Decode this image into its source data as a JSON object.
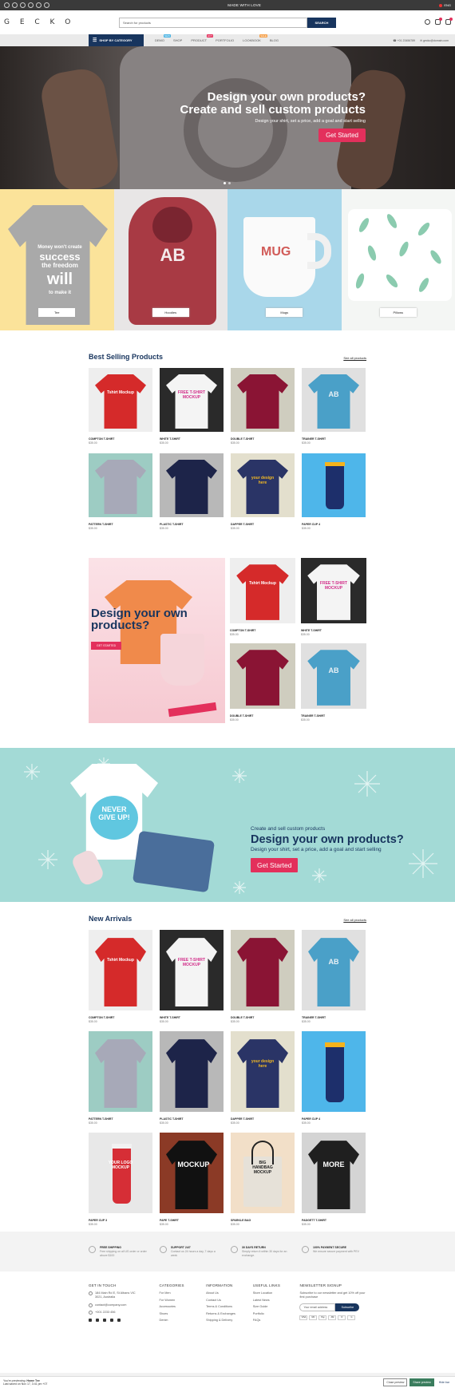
{
  "topbar": {
    "message": "MADE WITH LOVE",
    "lang": "ENG"
  },
  "header": {
    "logo": "G E C K O",
    "search_placeholder": "Search for products",
    "search_button": "SEARCH"
  },
  "nav": {
    "category_button": "SHOP BY CATEGORY",
    "items": [
      {
        "label": "DEMO",
        "tag": "NEW",
        "tag_color": "#4ab3e3"
      },
      {
        "label": "SHOP",
        "tag": "",
        "tag_color": ""
      },
      {
        "label": "PRODUCT",
        "tag": "HOT",
        "tag_color": "#e3305c"
      },
      {
        "label": "PORTFOLIO",
        "tag": "",
        "tag_color": ""
      },
      {
        "label": "LOOKBOOK",
        "tag": "SALE",
        "tag_color": "#f5a04a"
      },
      {
        "label": "BLOG",
        "tag": "",
        "tag_color": ""
      }
    ],
    "phone": "+01 23456789",
    "email": "gecko@domain.com"
  },
  "hero": {
    "title1": "Design your own products?",
    "title2": "Create and sell custom products",
    "subtitle": "Design your shirt, set a price, add a goal and start selling",
    "button": "Get Started"
  },
  "categories": [
    {
      "label": "Tee",
      "bg": "#fbe39a",
      "shirt_text": [
        "Money won't create",
        "success",
        "the freedom",
        "will",
        "to make it"
      ]
    },
    {
      "label": "Hoodies",
      "bg": "#e8e6e6"
    },
    {
      "label": "Mugs",
      "bg": "#a9d7ea",
      "mug_text": "MUG"
    },
    {
      "label": "Pillows",
      "bg": "#f4f6f4"
    }
  ],
  "best_selling": {
    "title": "Best Selling Products",
    "see_all": "See all products",
    "products": [
      {
        "name": "COMPTON T-SHIRT",
        "price": "$35.00",
        "bg": "#eeeeee",
        "shirt": "#d52a2a",
        "text": "Tshirt Mockup"
      },
      {
        "name": "WHITE T-SHIRT",
        "price": "$35.00",
        "bg": "#2a2a2a",
        "shirt": "#f4f4f4",
        "text": "FREE T-SHIRT MOCKUP"
      },
      {
        "name": "DOUBLE T-SHIRT",
        "price": "$35.00",
        "bg": "#cfcdbf",
        "shirt": "#8a1434",
        "text": ""
      },
      {
        "name": "TRAINER T-SHIRT",
        "price": "$35.00",
        "bg": "#e0e0e0",
        "shirt": "#4aa0c8",
        "text": "AB"
      },
      {
        "name": "PATTERN T-SHIRT",
        "price": "$35.00",
        "bg": "#9dccc3",
        "shirt": "#a7a9b8",
        "text": ""
      },
      {
        "name": "PLASTIC T-SHIRT",
        "price": "$35.00",
        "bg": "#b8b8b8",
        "shirt": "#1d2449",
        "text": ""
      },
      {
        "name": "DAPPER T-SHIRT",
        "price": "$35.00",
        "bg": "#e3dfcd",
        "shirt": "#2a3466",
        "text": "your design here"
      },
      {
        "name": "PAPER CUP 4",
        "price": "$35.00",
        "bg": "#4eb6ea",
        "shirt": "",
        "text": ""
      }
    ]
  },
  "promo": {
    "title": "Design your own products?",
    "button": "GET STARTED",
    "products": [
      {
        "name": "COMPTON T-SHIRT",
        "price": "$35.00",
        "bg": "#eeeeee",
        "shirt": "#d52a2a",
        "text": "Tshirt Mockup"
      },
      {
        "name": "WHITE T-SHIRT",
        "price": "$35.00",
        "bg": "#2a2a2a",
        "shirt": "#f4f4f4",
        "text": "FREE T-SHIRT MOCKUP"
      },
      {
        "name": "DOUBLE T-SHIRT",
        "price": "$35.00",
        "bg": "#cfcdbf",
        "shirt": "#8a1434",
        "text": ""
      },
      {
        "name": "TRAINER T-SHIRT",
        "price": "$35.00",
        "bg": "#e0e0e0",
        "shirt": "#4aa0c8",
        "text": "AB"
      }
    ]
  },
  "banner": {
    "subtitle": "Create and sell custom products",
    "title": "Design your own products?",
    "desc": "Design your shirt, set a price, add a goal and start selling",
    "button": "Get Started",
    "shirt_text": "NEVER GIVE UP!"
  },
  "new_arrivals": {
    "title": "New Arrivals",
    "see_all": "See all products",
    "products": [
      {
        "name": "COMPTON T-SHIRT",
        "price": "$35.00",
        "bg": "#eeeeee",
        "shirt": "#d52a2a",
        "text": "Tshirt Mockup"
      },
      {
        "name": "WHITE T-SHIRT",
        "price": "$35.00",
        "bg": "#2a2a2a",
        "shirt": "#f4f4f4",
        "text": "FREE T-SHIRT MOCKUP"
      },
      {
        "name": "DOUBLE T-SHIRT",
        "price": "$35.00",
        "bg": "#cfcdbf",
        "shirt": "#8a1434",
        "text": ""
      },
      {
        "name": "TRAINER T-SHIRT",
        "price": "$35.00",
        "bg": "#e0e0e0",
        "shirt": "#4aa0c8",
        "text": "AB"
      },
      {
        "name": "PATTERN T-SHIRT",
        "price": "$35.00",
        "bg": "#9dccc3",
        "shirt": "#a7a9b8",
        "text": ""
      },
      {
        "name": "PLASTIC T-SHIRT",
        "price": "$35.00",
        "bg": "#b8b8b8",
        "shirt": "#1d2449",
        "text": ""
      },
      {
        "name": "DAPPER T-SHIRT",
        "price": "$35.00",
        "bg": "#e3dfcd",
        "shirt": "#2a3466",
        "text": "your design here"
      },
      {
        "name": "PAPER CUP 4",
        "price": "$35.00",
        "bg": "#4eb6ea",
        "shirt": "",
        "text": ""
      },
      {
        "name": "PAPER CUP 3",
        "price": "$35.00",
        "bg": "#e8e8e8",
        "shirt": "",
        "text": "YOUR LOGO MOCKUP"
      },
      {
        "name": "PAPE T-SHIRT",
        "price": "$35.00",
        "bg": "#8b3a26",
        "shirt": "#111111",
        "text": "MOCKUP"
      },
      {
        "name": "SPARKLE BAG",
        "price": "$35.00",
        "bg": "#f2dfc8",
        "shirt": "",
        "text": "BIG HANDBAG MOCKUP"
      },
      {
        "name": "PADGETT T-SHIRT",
        "price": "$35.00",
        "bg": "#d4d4d4",
        "shirt": "#1f1f1f",
        "text": "MORE"
      }
    ]
  },
  "features": [
    {
      "title": "FREE SHIPPING",
      "desc": "Free shipping on all US order or order above $100"
    },
    {
      "title": "SUPPORT 24/7",
      "desc": "Contact us 24 hours a day, 7 days a week"
    },
    {
      "title": "30 DAYS RETURN",
      "desc": "Simply return it within 30 days for an exchange."
    },
    {
      "title": "100% PAYMENT SECURE",
      "desc": "We ensure secure payment with PEV"
    }
  ],
  "footer": {
    "get_in_touch": {
      "title": "GET IN TOUCH",
      "address": "184 Main Rd E, St Albans VIC 3021, Australia",
      "email": "contact@company.com",
      "phone": "+001 2233 456"
    },
    "categories": {
      "title": "CATEGORIES",
      "links": [
        "For Men",
        "For Women",
        "Accessories",
        "Shoes",
        "Denim"
      ]
    },
    "information": {
      "title": "INFORMATION",
      "links": [
        "About Us",
        "Contact Us",
        "Terms & Conditions",
        "Returns & Exchanges",
        "Shipping & Delivery"
      ]
    },
    "useful_links": {
      "title": "USEFUL LINKS",
      "links": [
        "Store Location",
        "Latest News",
        "Size Guide",
        "Portfolio",
        "FAQs"
      ]
    },
    "newsletter": {
      "title": "NEWSLETTER SIGNUP",
      "desc": "Subscribe to our newsletter and get 10% off your first purchase",
      "placeholder": "Your email address",
      "button": "Subscribe",
      "payments": [
        "VISA",
        "MC",
        "Pay",
        "AM",
        "D",
        "G"
      ]
    }
  },
  "preview": {
    "label": "You're previewing:",
    "theme": "Home Tee",
    "saved": "Last saved on Nov 17, 3:41 pm +07",
    "close": "Close preview",
    "share": "Share preview",
    "hide": "Hide bar"
  }
}
